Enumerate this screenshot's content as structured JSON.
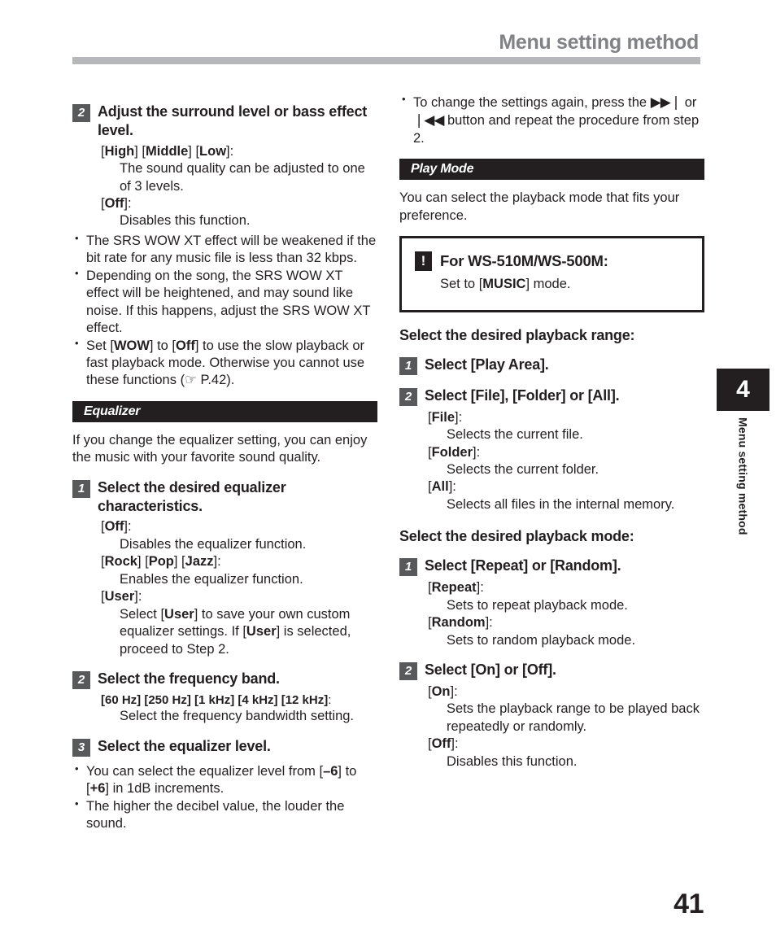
{
  "header": {
    "title": "Menu setting method"
  },
  "page_number": "41",
  "chapter_tab": {
    "number": "4",
    "label": "Menu setting method"
  },
  "left_column": {
    "step2": {
      "badge": "2",
      "heading": "Adjust the surround level or bass effect level."
    },
    "defs1": [
      {
        "term_prefix": "[",
        "terms": "High] [Middle] [Low",
        "term_suffix": "]:",
        "desc": "The sound quality can be adjusted to one of 3 levels."
      },
      {
        "term_prefix": "[",
        "terms": "Off",
        "term_suffix": "]:",
        "desc": "Disables this function."
      }
    ],
    "bullets1": [
      "The SRS WOW XT effect will be weakened if the bit rate for any music file is less than 32 kbps.",
      "Depending on the song, the SRS WOW XT effect will be heightened, and may sound like noise. If this happens, adjust the SRS WOW XT effect.",
      "Set [WOW] to [Off] to use the slow playback or fast playback mode. Otherwise you cannot use these functions (☞ P.42)."
    ],
    "banner_equalizer": "Equalizer",
    "equalizer_intro": "If you change the equalizer setting, you can enjoy the music with your favorite sound quality.",
    "step1": {
      "badge": "1",
      "heading": "Select the desired equalizer characteristics."
    },
    "defs2": [
      {
        "term": "[Off]:",
        "desc": "Disables the equalizer function."
      },
      {
        "term": "[Rock] [Pop] [Jazz]:",
        "desc": "Enables the equalizer function."
      },
      {
        "term": "[User]:",
        "desc": "Select [User] to save your own custom equalizer settings. If [User] is selected, proceed to Step 2."
      }
    ],
    "step2b": {
      "badge": "2",
      "heading": "Select the frequency band."
    },
    "freq_line": "[60 Hz] [250 Hz] [1 kHz] [4 kHz] [12 kHz]:",
    "freq_desc": "Select the frequency bandwidth setting.",
    "step3": {
      "badge": "3",
      "heading": "Select the equalizer level."
    },
    "bullets2": [
      "You can select the equalizer level from [–6] to [+6] in 1dB increments.",
      "The higher the decibel value, the louder the sound."
    ]
  },
  "right_column": {
    "bullet_top": "To change the settings again, press the ▶▶❘ or ❘◀◀ button and repeat the procedure from step 2.",
    "bullet_top_part1": "To change the settings again, press the",
    "bullet_top_glyph_fwd": "▶▶❘",
    "bullet_top_mid": "or",
    "bullet_top_glyph_back": "❘◀◀",
    "bullet_top_part2": "button and repeat the procedure from step 2.",
    "banner_play_mode": "Play Mode",
    "play_mode_intro": "You can select the playback mode that fits your preference.",
    "note_box": {
      "icon": "!",
      "title": "For WS-510M/WS-500M:",
      "body": "Set to [MUSIC] mode."
    },
    "subhead_range": "Select the desired playback range:",
    "range_step1": {
      "badge": "1",
      "heading": "Select [Play Area]."
    },
    "range_step2": {
      "badge": "2",
      "heading": "Select [File], [Folder] or [All]."
    },
    "range_defs": [
      {
        "term": "[File]:",
        "desc": "Selects the current file."
      },
      {
        "term": "[Folder]:",
        "desc": "Selects the current folder."
      },
      {
        "term": "[All]:",
        "desc": "Selects all files in the internal memory."
      }
    ],
    "subhead_mode": "Select the desired playback mode:",
    "mode_step1": {
      "badge": "1",
      "heading": "Select [Repeat] or [Random]."
    },
    "mode_defs": [
      {
        "term": "[Repeat]:",
        "desc": "Sets to repeat playback mode."
      },
      {
        "term": "[Random]:",
        "desc": "Sets to random playback mode."
      }
    ],
    "mode_step2": {
      "badge": "2",
      "heading": "Select [On] or [Off]."
    },
    "mode_defs2": [
      {
        "term": "[On]:",
        "desc": "Sets the playback range to be played back repeatedly or randomly."
      },
      {
        "term": "[Off]:",
        "desc": "Disables this function."
      }
    ]
  }
}
